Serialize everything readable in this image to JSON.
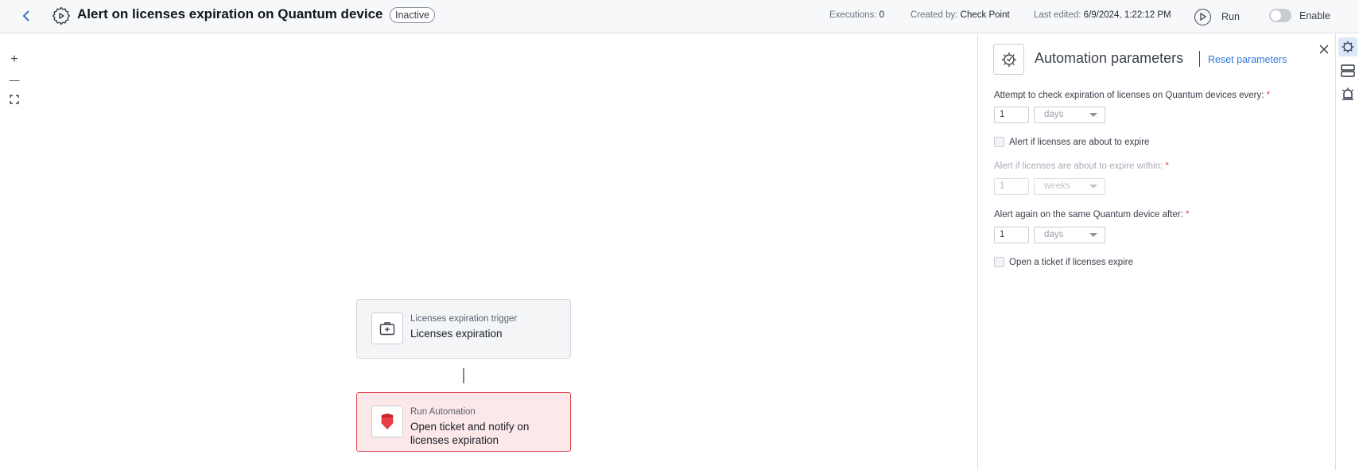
{
  "header": {
    "title": "Alert on licenses expiration on Quantum device",
    "status": "Inactive",
    "executions_label": "Executions:",
    "executions_value": "0",
    "created_by_label": "Created by:",
    "created_by_value": "Check Point",
    "last_edited_label": "Last edited:",
    "last_edited_value": "6/9/2024, 1:22:12 PM",
    "run_label": "Run",
    "enable_label": "Enable",
    "enable_on": false
  },
  "canvas": {
    "zoom_in": "+",
    "zoom_out": "—",
    "fit_icon": "fit-screen-icon"
  },
  "flow": {
    "trigger": {
      "subtitle": "Licenses expiration trigger",
      "title": "Licenses expiration",
      "icon": "medical-kit-icon"
    },
    "action": {
      "subtitle": "Run Automation",
      "title": "Open ticket and notify on licenses expiration",
      "icon": "red-shield-icon",
      "accent": "#e0484e"
    }
  },
  "panel": {
    "title": "Automation parameters",
    "reset_label": "Reset parameters",
    "icon": "automation-gear-icon",
    "fields": {
      "check_every": {
        "label": "Attempt to check expiration of licenses on Quantum devices every:",
        "required_mark": "*",
        "value": "1",
        "unit": "days"
      },
      "alert_about_to_expire": {
        "label": "Alert if licenses are about to expire",
        "checked": false
      },
      "expire_within": {
        "label": "Alert if licenses are about to expire within:",
        "required_mark": "*",
        "value": "1",
        "unit": "weeks",
        "disabled": true
      },
      "alert_again": {
        "label": "Alert again on the same Quantum device after:",
        "required_mark": "*",
        "value": "1",
        "unit": "days"
      },
      "open_ticket": {
        "label": "Open a ticket if licenses expire",
        "checked": false
      }
    }
  },
  "rail": {
    "items": [
      "automation-gear-icon",
      "layout-rows-icon",
      "alarm-bell-icon"
    ]
  },
  "colors": {
    "accent_blue": "#2f79d8",
    "danger_red": "#e0484e"
  }
}
